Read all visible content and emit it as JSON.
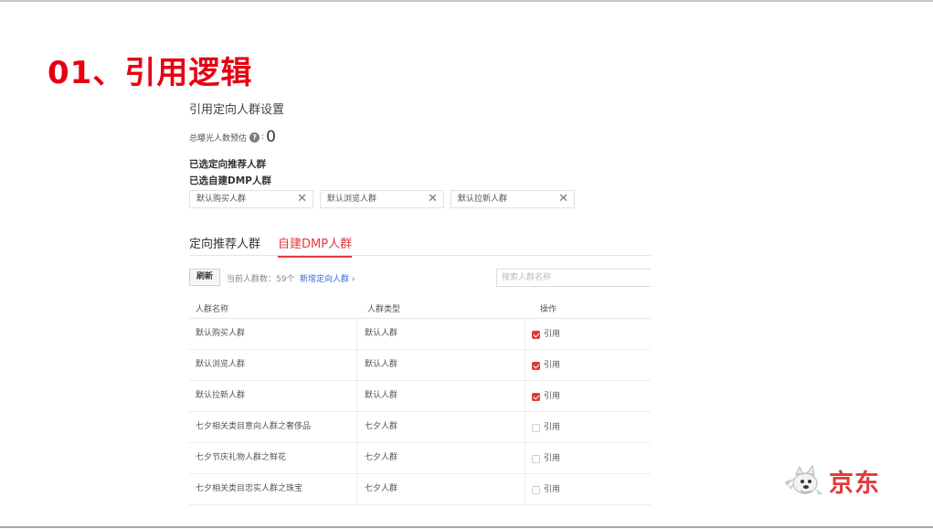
{
  "slide": {
    "title": "01、引用逻辑",
    "accent_color": "#e60012",
    "logo": {
      "text": "京东",
      "icon": "jd-dog-mascot"
    }
  },
  "panel": {
    "title": "引用定向人群设置",
    "exposure": {
      "label": "总曝光人数预估",
      "help_icon": "question-circle-icon",
      "colon": ":",
      "value": "0"
    },
    "selected_recommended": "已选定向推荐人群",
    "selected_dmp": "已选自建DMP人群",
    "chips": [
      {
        "label": "默认购买人群",
        "close": "✕"
      },
      {
        "label": "默认浏览人群",
        "close": "✕"
      },
      {
        "label": "默认拉新人群",
        "close": "✕"
      }
    ],
    "tabs": [
      {
        "label": "定向推荐人群",
        "active": false
      },
      {
        "label": "自建DMP人群",
        "active": true
      }
    ],
    "toolbar": {
      "refresh": "刷新",
      "count_text": "当前人群数：59个",
      "new_link": "新增定向人群",
      "new_link_arrow": "›",
      "search_placeholder": "搜索人群名称"
    },
    "table": {
      "headers": {
        "name": "人群名称",
        "type": "人群类型",
        "op": "操作"
      },
      "rows": [
        {
          "name": "默认购买人群",
          "type": "默认人群",
          "op": "引用",
          "checked": true
        },
        {
          "name": "默认浏览人群",
          "type": "默认人群",
          "op": "引用",
          "checked": true
        },
        {
          "name": "默认拉新人群",
          "type": "默认人群",
          "op": "引用",
          "checked": true
        },
        {
          "name": "七夕相关类目意向人群之奢侈品",
          "type": "七夕人群",
          "op": "引用",
          "checked": false
        },
        {
          "name": "七夕节庆礼物人群之鲜花",
          "type": "七夕人群",
          "op": "引用",
          "checked": false
        },
        {
          "name": "七夕相关类目忠实人群之珠宝",
          "type": "七夕人群",
          "op": "引用",
          "checked": false
        }
      ]
    }
  }
}
